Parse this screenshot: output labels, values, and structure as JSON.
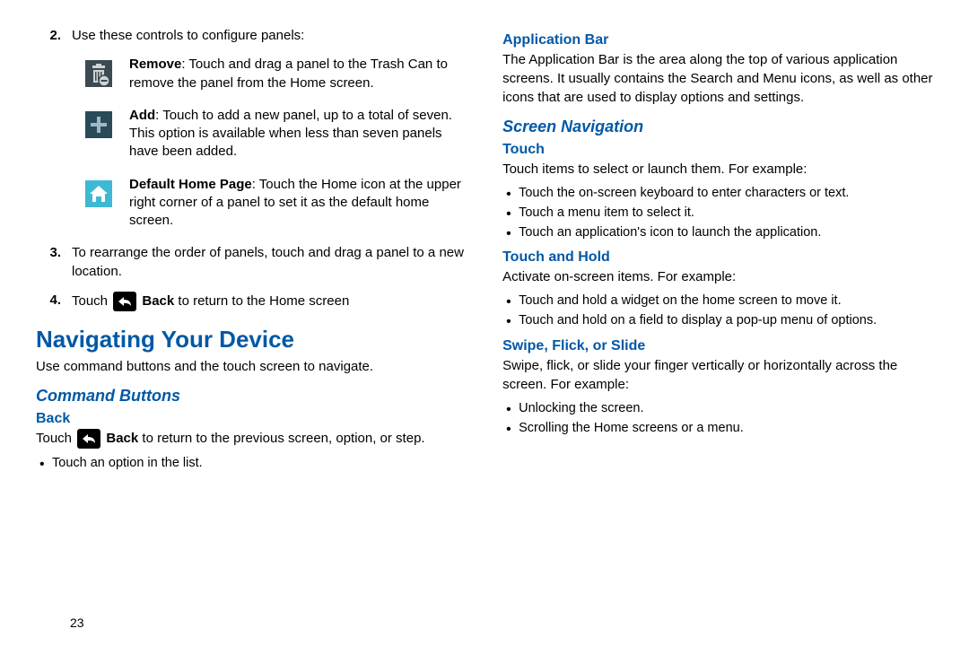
{
  "left": {
    "step2": {
      "num": "2.",
      "text": "Use these controls to configure panels:"
    },
    "rows": [
      {
        "label": "Remove",
        "text": ": Touch and drag a panel to the Trash Can to remove the panel from the Home screen."
      },
      {
        "label": "Add",
        "text": ": Touch to add a new panel, up to a total of seven. This option is available when less than seven panels have been added."
      },
      {
        "label": "Default Home Page",
        "text": ": Touch the Home icon at the upper right corner of a panel to set it as the default home screen."
      }
    ],
    "step3": {
      "num": "3.",
      "text": "To rearrange the order of panels, touch and drag a panel to a new location."
    },
    "step4": {
      "num": "4.",
      "pre": "Touch ",
      "bold": "Back",
      "post": " to return to the Home screen"
    },
    "h1": "Navigating Your Device",
    "intro": "Use command buttons and the touch screen to navigate.",
    "h2": "Command Buttons",
    "h3": "Back",
    "back_pre": "Touch ",
    "back_bold": "Back",
    "back_post": " to return to the previous screen, option, or step.",
    "back_bullet": "Touch an option in the list."
  },
  "right": {
    "h3a": "Application Bar",
    "appbar": "The Application Bar is the area along the top of various application screens. It usually contains the Search and Menu icons, as well as other icons that are used to display options and settings.",
    "h2": "Screen Navigation",
    "touch_h": "Touch",
    "touch_p": "Touch items to select or launch them. For example:",
    "touch_items": [
      "Touch the on-screen keyboard to enter characters or text.",
      "Touch a menu item to select it.",
      "Touch an application's icon to launch the application."
    ],
    "hold_h": "Touch and Hold",
    "hold_p": "Activate on-screen items. For example:",
    "hold_items": [
      "Touch and hold a widget on the home screen to move it.",
      "Touch and hold on a field to display a pop-up menu of options."
    ],
    "swipe_h": "Swipe, Flick, or Slide",
    "swipe_p": "Swipe, flick, or slide your finger vertically or horizontally across the screen. For example:",
    "swipe_items": [
      "Unlocking the screen.",
      "Scrolling the Home screens or a menu."
    ]
  },
  "pagenum": "23"
}
